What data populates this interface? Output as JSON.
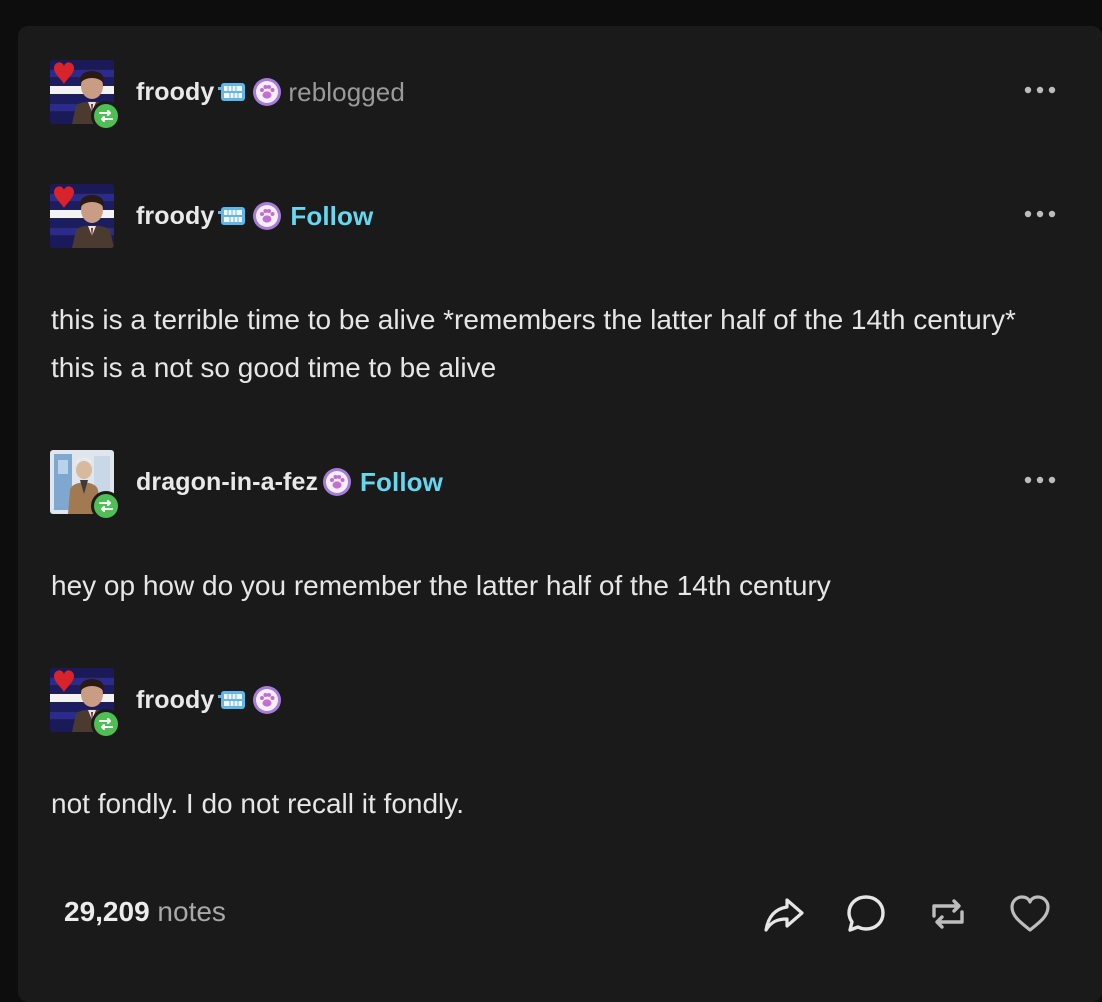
{
  "post": {
    "reblog_header": {
      "username": "froody",
      "action": "reblogged"
    },
    "threads": [
      {
        "username": "froody",
        "follow_label": "Follow",
        "text": "this is a terrible time to be alive *remembers the latter half of the 14th century* this is a not so good time to be alive"
      },
      {
        "username": "dragon-in-a-fez",
        "follow_label": "Follow",
        "text": "hey op how do you remember the latter half of the 14th century"
      },
      {
        "username": "froody",
        "text": "not fondly. I do not recall it fondly."
      }
    ],
    "notes_count": "29,209",
    "notes_label": "notes"
  },
  "icons": [
    "more-options-icon",
    "share-icon",
    "reply-icon",
    "reblog-icon",
    "like-icon",
    "reblog-badge-icon",
    "paw-badge-icon",
    "teeth-badge-icon"
  ],
  "colors": {
    "background": "#0d0d0d",
    "card": "#1a1a1a",
    "follow": "#67d7f0",
    "reblog_green": "#4fbf55",
    "paw_purple": "#a77bd6"
  }
}
